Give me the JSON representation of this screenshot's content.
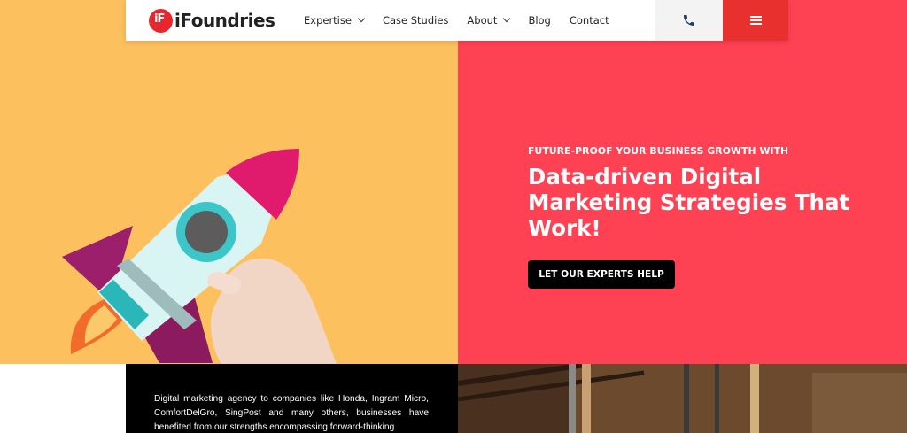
{
  "brand": {
    "logo_mark": "iF",
    "logo_text": "iFoundries"
  },
  "nav": {
    "items": [
      {
        "label": "Expertise",
        "has_dropdown": true
      },
      {
        "label": "Case Studies",
        "has_dropdown": false
      },
      {
        "label": "About",
        "has_dropdown": true
      },
      {
        "label": "Blog",
        "has_dropdown": false
      },
      {
        "label": "Contact",
        "has_dropdown": false
      }
    ],
    "phone_icon": "phone-icon",
    "menu_icon": "hamburger-menu-icon"
  },
  "hero": {
    "eyebrow": "FUTURE-PROOF YOUR BUSINESS GROWTH WITH",
    "headline": "Data-driven Digital Marketing Strategies That Work!",
    "cta_label": "LET OUR EXPERTS HELP",
    "image": "hand-holding-paper-rocket"
  },
  "about": {
    "text": "Digital marketing agency to companies like Honda, Ingram Micro, ComfortDelGro, SingPost and many others, businesses have benefited from our strengths encompassing forward-thinking"
  },
  "colors": {
    "accent_red": "#e8302f",
    "hero_pink": "#ff4154",
    "hero_yellow": "#fcc05e",
    "cta_black": "#000000"
  }
}
